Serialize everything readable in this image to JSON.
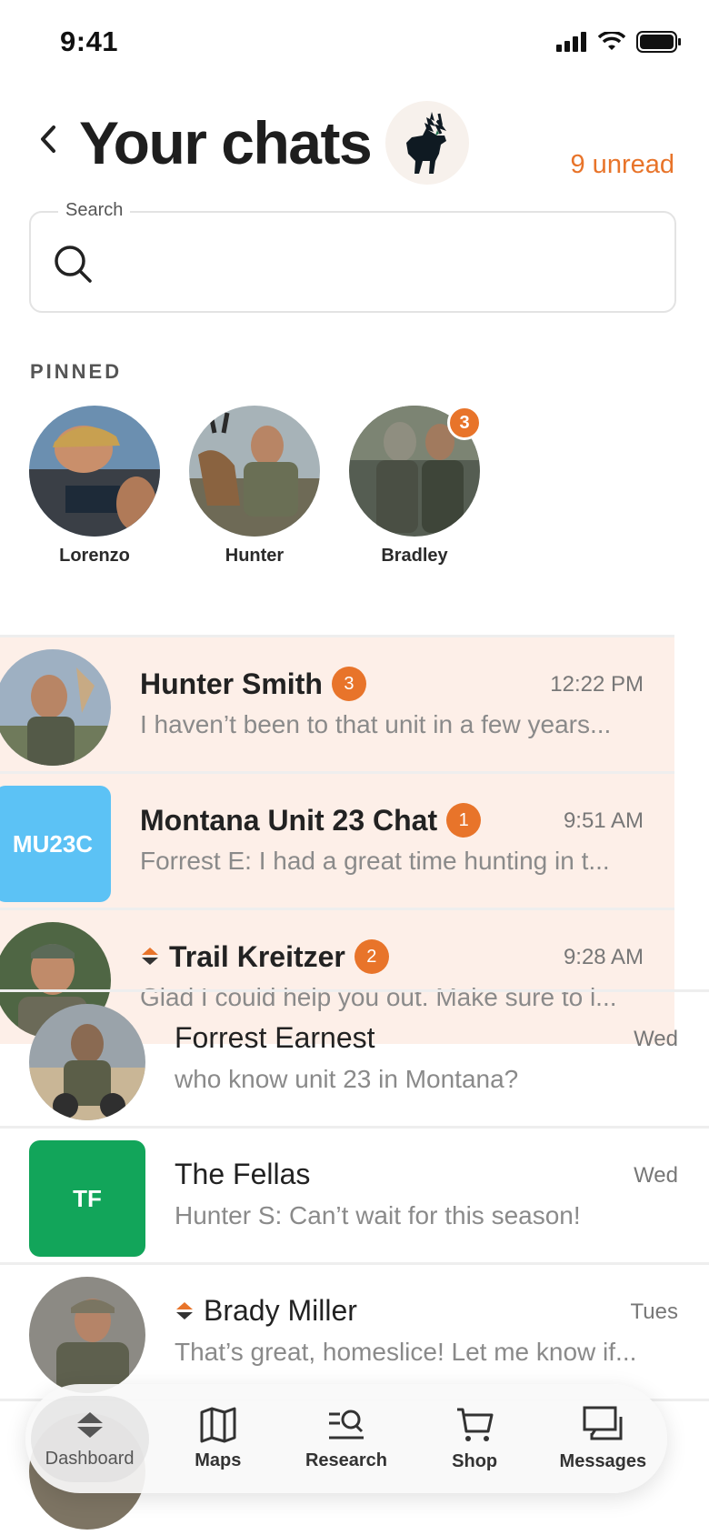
{
  "status": {
    "time": "9:41"
  },
  "header": {
    "title": "Your chats",
    "unread": "9 unread"
  },
  "search": {
    "label": "Search",
    "placeholder": ""
  },
  "pinned": {
    "label": "PINNED",
    "items": [
      {
        "name": "Lorenzo",
        "badge": ""
      },
      {
        "name": "Hunter",
        "badge": ""
      },
      {
        "name": "Bradley",
        "badge": "3"
      }
    ]
  },
  "chats": [
    {
      "name": "Hunter Smith",
      "badge": "3",
      "time": "12:22 PM",
      "preview": "I haven’t been to that unit in a few years...",
      "unread": true
    },
    {
      "name": "Montana Unit 23 Chat",
      "initials": "MU23C",
      "badge": "1",
      "time": "9:51 AM",
      "preview": "Forrest E: I had a great time hunting in t...",
      "unread": true,
      "color": "#5cc2f5"
    },
    {
      "name": "Trail Kreitzer",
      "badge": "2",
      "time": "9:28 AM",
      "preview": "Glad I could help you out. Make sure to l...",
      "unread": true
    },
    {
      "name": "Forrest Earnest",
      "time": "Wed",
      "preview": "who know unit 23 in Montana?",
      "unread": false
    },
    {
      "name": "The Fellas",
      "initials": "TF",
      "time": "Wed",
      "preview": "Hunter S: Can’t wait for this season!",
      "unread": false,
      "color": "#12a55a"
    },
    {
      "name": "Brady Miller",
      "time": "Tues",
      "preview": "That’s great, homeslice! Let me know if...",
      "unread": false
    }
  ],
  "tabs": [
    {
      "label": "Dashboard",
      "icon": "dashboard-icon"
    },
    {
      "label": "Maps",
      "icon": "map-icon"
    },
    {
      "label": "Research",
      "icon": "research-icon"
    },
    {
      "label": "Shop",
      "icon": "cart-icon"
    },
    {
      "label": "Messages",
      "icon": "messages-icon"
    }
  ],
  "colors": {
    "accent": "#e8742a",
    "unread_bg": "#fdefe8"
  }
}
